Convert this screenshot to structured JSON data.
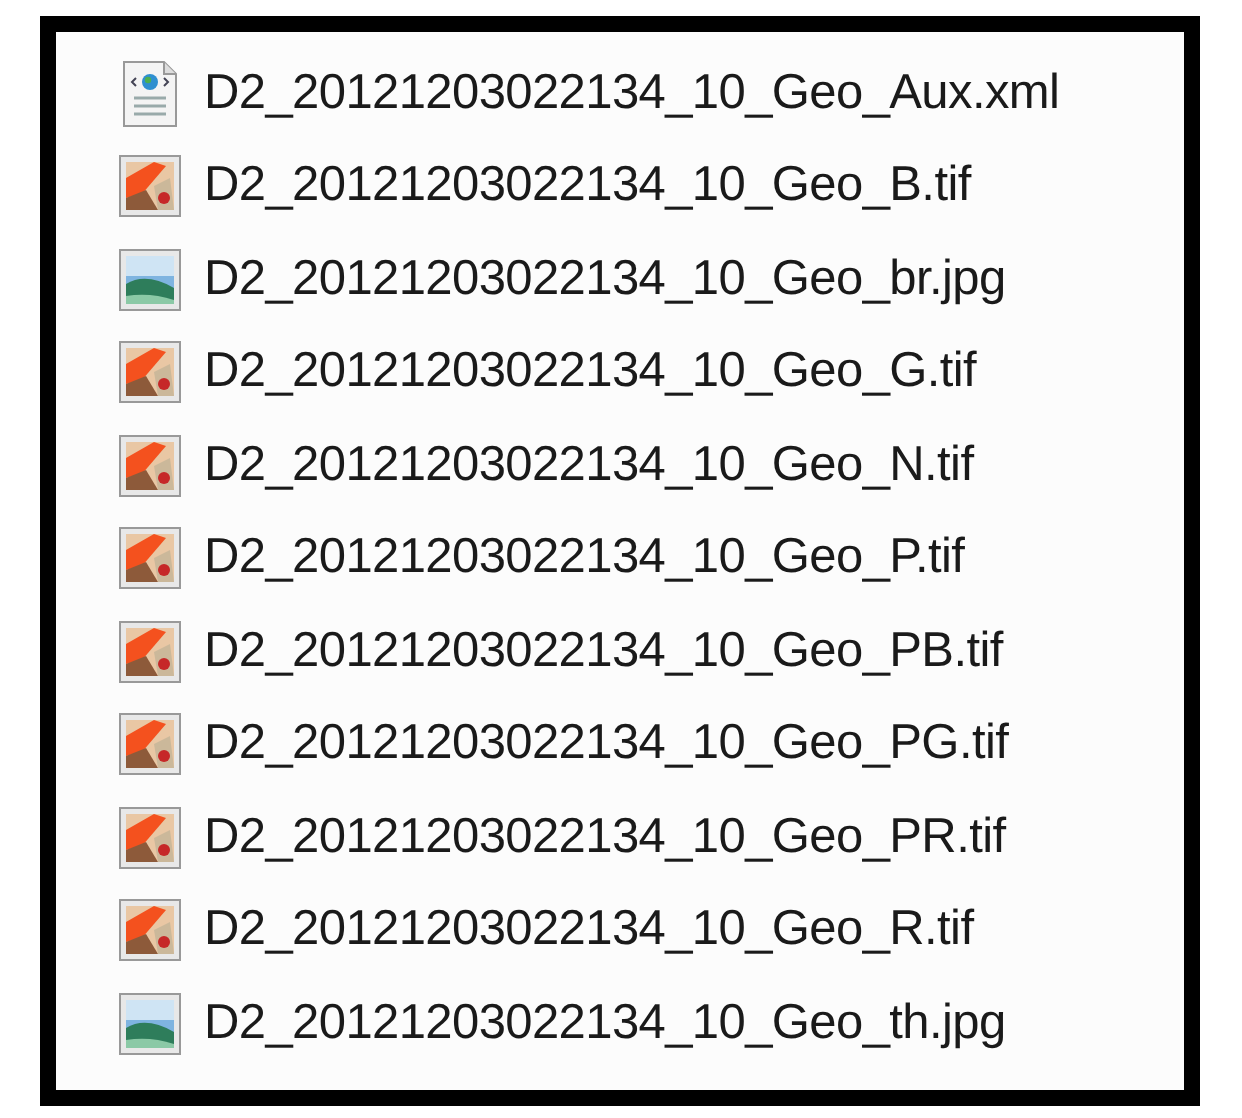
{
  "files": [
    {
      "name": "D2_20121203022134_10_Geo_Aux.xml",
      "kind": "xml"
    },
    {
      "name": "D2_20121203022134_10_Geo_B.tif",
      "kind": "tif"
    },
    {
      "name": "D2_20121203022134_10_Geo_br.jpg",
      "kind": "jpg"
    },
    {
      "name": "D2_20121203022134_10_Geo_G.tif",
      "kind": "tif"
    },
    {
      "name": "D2_20121203022134_10_Geo_N.tif",
      "kind": "tif"
    },
    {
      "name": "D2_20121203022134_10_Geo_P.tif",
      "kind": "tif"
    },
    {
      "name": "D2_20121203022134_10_Geo_PB.tif",
      "kind": "tif"
    },
    {
      "name": "D2_20121203022134_10_Geo_PG.tif",
      "kind": "tif"
    },
    {
      "name": "D2_20121203022134_10_Geo_PR.tif",
      "kind": "tif"
    },
    {
      "name": "D2_20121203022134_10_Geo_R.tif",
      "kind": "tif"
    },
    {
      "name": "D2_20121203022134_10_Geo_th.jpg",
      "kind": "jpg"
    }
  ]
}
